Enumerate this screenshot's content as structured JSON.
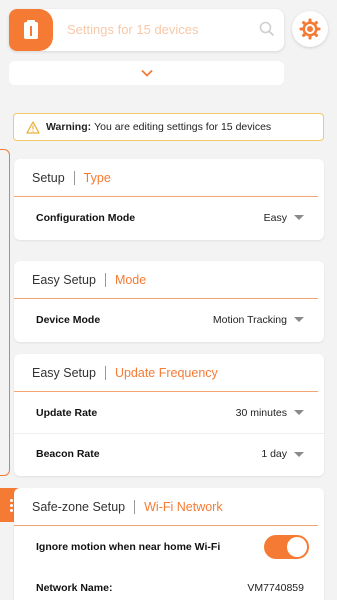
{
  "colors": {
    "accent": "#f57b35",
    "warning_border": "#f0c96a",
    "background": "#f3f3f3"
  },
  "search": {
    "placeholder": "Settings for 15 devices",
    "icon": "search-icon"
  },
  "warning": {
    "bold": "Warning:",
    "text": "You are editing settings for 15 devices",
    "icon": "warning-triangle-icon"
  },
  "cards": [
    {
      "section": "Setup",
      "title": "Type",
      "rows": [
        {
          "label": "Configuration Mode",
          "value": "Easy"
        }
      ]
    },
    {
      "section": "Easy Setup",
      "title": "Mode",
      "rows": [
        {
          "label": "Device Mode",
          "value": "Motion Tracking"
        }
      ]
    },
    {
      "section": "Easy Setup",
      "title": "Update Frequency",
      "rows": [
        {
          "label": "Update Rate",
          "value": "30 minutes"
        },
        {
          "label": "Beacon Rate",
          "value": "1 day"
        }
      ]
    },
    {
      "section": "Safe-zone Setup",
      "title": "Wi-Fi Network",
      "rows": [
        {
          "label": "Ignore motion when near home Wi-Fi",
          "toggle_on": true
        },
        {
          "label": "Network Name:",
          "value": "VM7740859"
        }
      ]
    }
  ]
}
